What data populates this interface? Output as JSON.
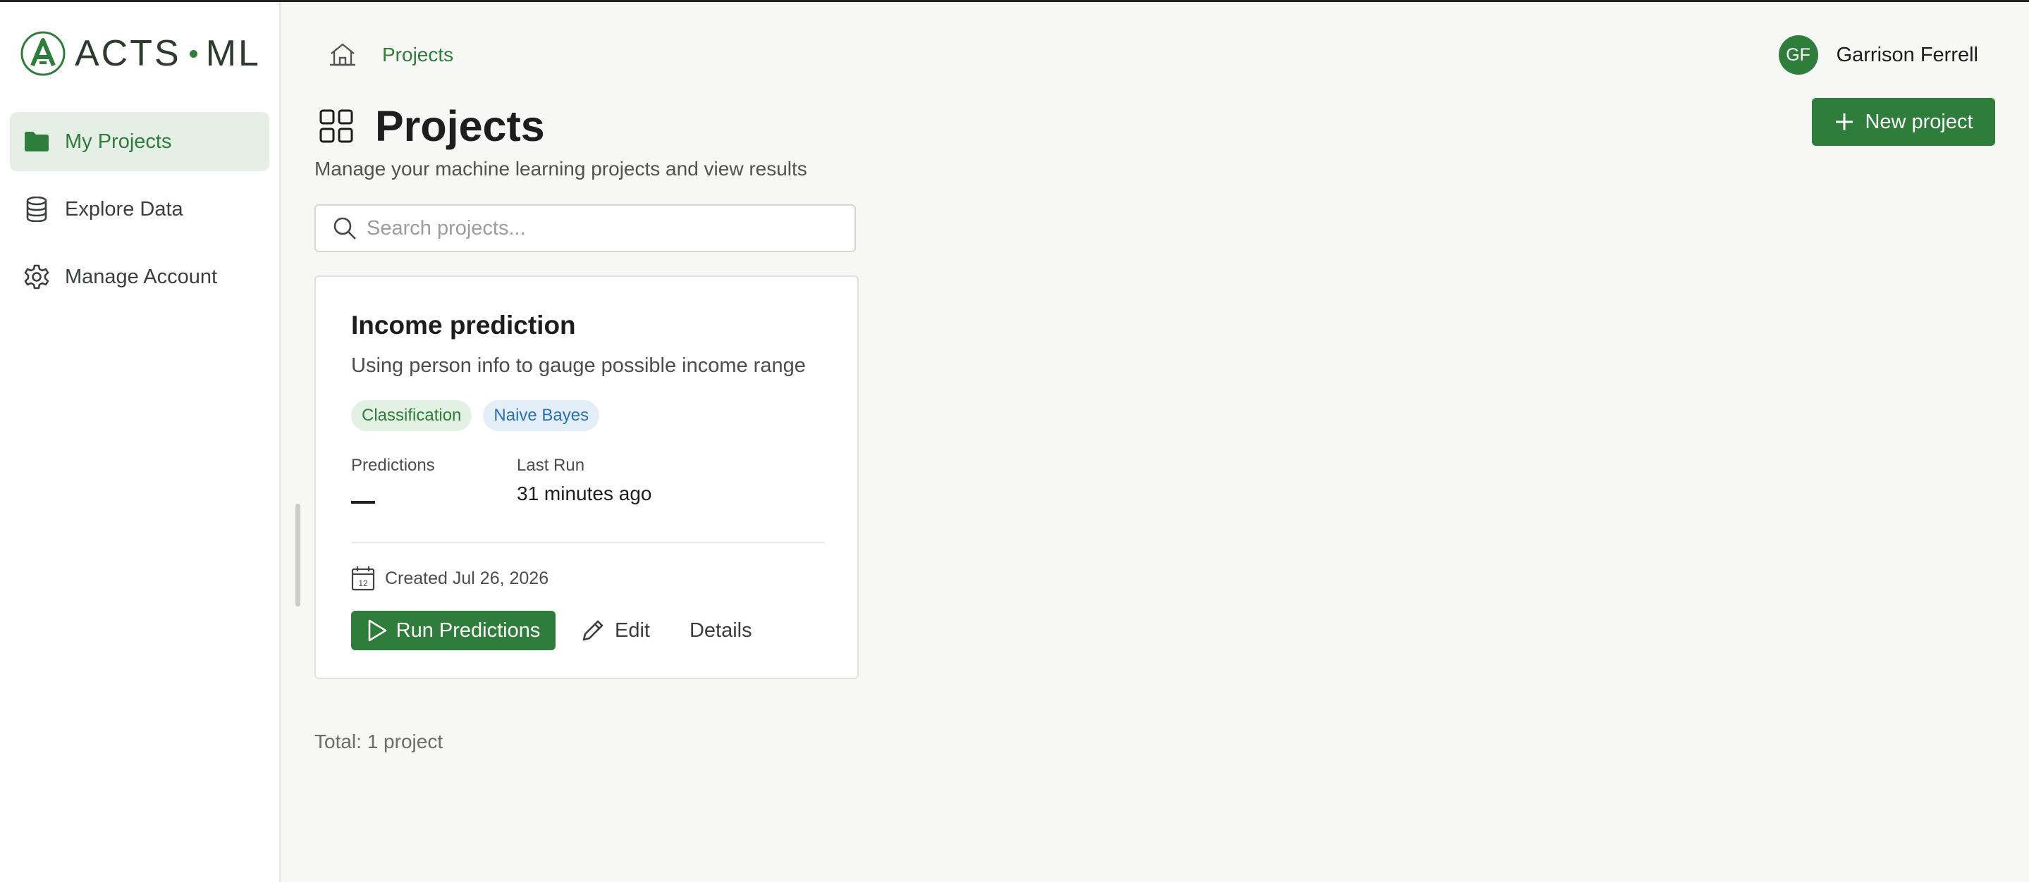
{
  "app": {
    "logo_left": "ACTS",
    "logo_right": "ML"
  },
  "sidebar": {
    "items": [
      {
        "label": "My Projects",
        "icon": "folder-icon",
        "active": true
      },
      {
        "label": "Explore Data",
        "icon": "database-icon",
        "active": false
      },
      {
        "label": "Manage Account",
        "icon": "gear-icon",
        "active": false
      }
    ]
  },
  "header": {
    "breadcrumb": "Projects",
    "user": {
      "initials": "GF",
      "name": "Garrison Ferrell"
    },
    "new_button": "New project"
  },
  "page": {
    "title": "Projects",
    "subtitle": "Manage your machine learning projects and view results"
  },
  "search": {
    "placeholder": "Search projects...",
    "value": ""
  },
  "projects": [
    {
      "title": "Income prediction",
      "description": "Using person info to gauge possible income range",
      "tags": [
        "Classification",
        "Naive Bayes"
      ],
      "stats": {
        "predictions_label": "Predictions",
        "predictions_value": "—",
        "last_run_label": "Last Run",
        "last_run_value": "31 minutes ago"
      },
      "created": "Created Jul 26, 2026",
      "calendar_day": "12",
      "actions": {
        "run": "Run Predictions",
        "edit": "Edit",
        "details": "Details"
      }
    }
  ],
  "footer": {
    "total": "Total: 1 project"
  },
  "colors": {
    "accent": "#2e7d3a",
    "accent_light": "#e6efe6",
    "tag_blue": "#2b6fb5"
  }
}
